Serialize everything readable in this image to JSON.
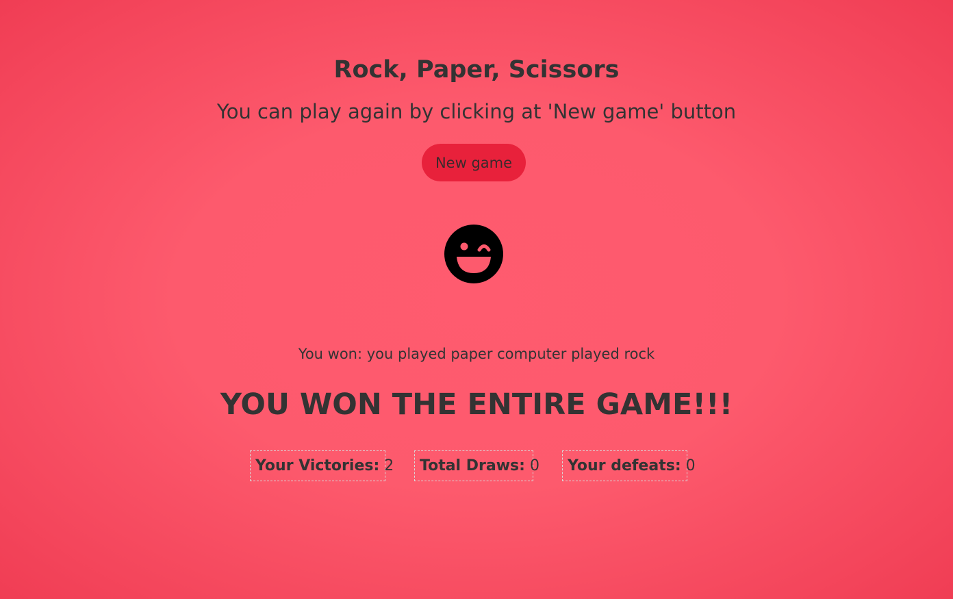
{
  "header": {
    "title": "Rock, Paper, Scissors",
    "subtitle": "You can play again by clicking at 'New game' button"
  },
  "controls": {
    "new_game_label": "New game"
  },
  "result": {
    "icon": "winking-laughing-face-icon",
    "round_message": "You won: you played paper computer played rock",
    "final_message": "YOU WON THE ENTIRE GAME!!!"
  },
  "scores": {
    "victories_label": "Your Victories:",
    "victories_value": "2",
    "draws_label": "Total Draws:",
    "draws_value": "0",
    "defeats_label": "Your defeats:",
    "defeats_value": "0"
  },
  "colors": {
    "background": "#fd5a6d",
    "button": "#e8213b",
    "text": "#333333",
    "icon": "#000000"
  }
}
